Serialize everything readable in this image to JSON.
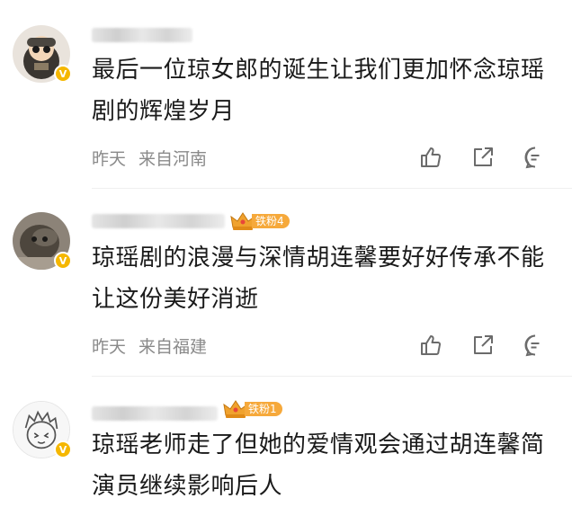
{
  "comments": [
    {
      "text": "最后一位琼女郎的诞生让我们更加怀念琼瑶剧的辉煌岁月",
      "time": "昨天",
      "location": "来自河南",
      "fan_badge": null
    },
    {
      "text": "琼瑶剧的浪漫与深情胡连馨要好好传承不能让这份美好消逝",
      "time": "昨天",
      "location": "来自福建",
      "fan_badge": "铁粉4"
    },
    {
      "text": "琼瑶老师走了但她的爱情观会通过胡连馨简演员继续影响后人",
      "time": "",
      "location": "",
      "fan_badge": "铁粉1"
    }
  ],
  "icons": {
    "like": "thumbs-up-icon",
    "share": "share-icon",
    "reply": "comment-icon",
    "verified": "verified-v-icon",
    "crown": "crown-icon"
  },
  "colors": {
    "badge_orange": "#f6a93b",
    "verified_gold": "#f5b700",
    "meta_gray": "#8a8a8a"
  }
}
